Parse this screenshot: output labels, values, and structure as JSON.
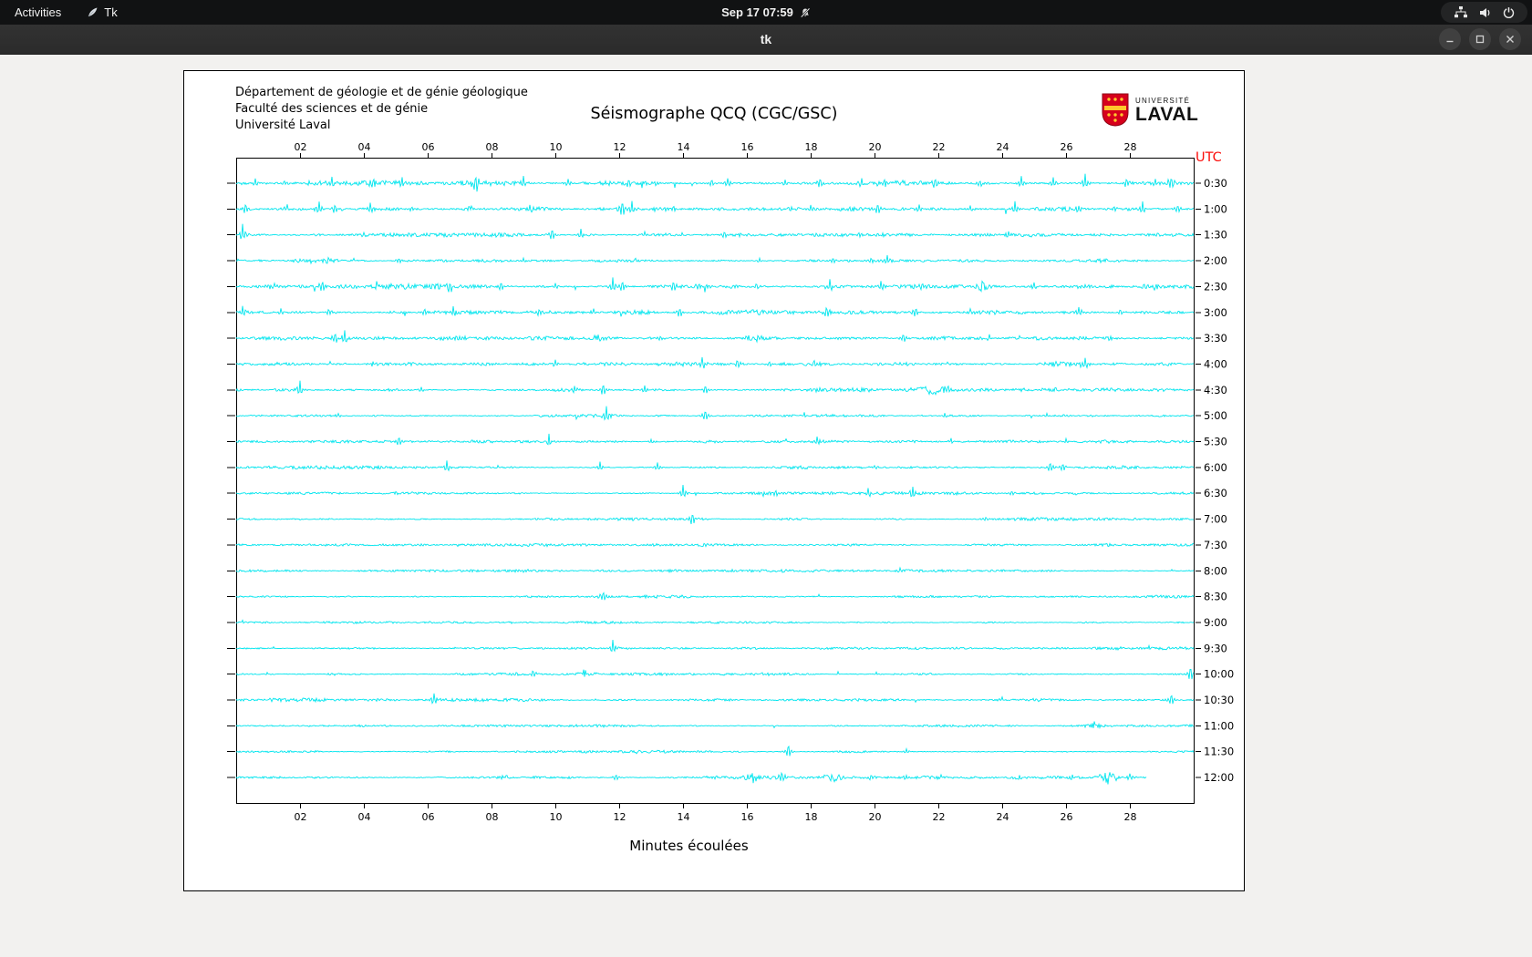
{
  "topbar": {
    "activities": "Activities",
    "app_name": "Tk",
    "clock": "Sep 17 07:59"
  },
  "window": {
    "title": "tk"
  },
  "canvas_header": {
    "line1": "Département de géologie et de génie géologique",
    "line2": "Faculté des sciences et de génie",
    "line3": "Université Laval"
  },
  "logo": {
    "top": "UNIVERSITÉ",
    "bottom": "LAVAL",
    "shield_red": "#d6001c",
    "shield_gold": "#ffc72c"
  },
  "chart_data": {
    "type": "line",
    "title": "Séismographe QCQ (CGC/GSC)",
    "xlabel": "Minutes écoulées",
    "utc_label": "UTC",
    "x_tick_labels": [
      "02",
      "04",
      "06",
      "08",
      "10",
      "12",
      "14",
      "16",
      "18",
      "20",
      "22",
      "24",
      "26",
      "28"
    ],
    "x_range_minutes": [
      0,
      30
    ],
    "trace_interval_minutes": 30,
    "legend_position": "none",
    "grid": false,
    "colors": {
      "trace": "#00e5ee",
      "axis": "#000000",
      "utc": "#fb0f0c"
    },
    "traces": [
      {
        "label": "0:30",
        "noise": 1.7,
        "events": [
          [
            0.6,
            5
          ],
          [
            1.5,
            4
          ],
          [
            3.0,
            7
          ],
          [
            4.3,
            10
          ],
          [
            5.2,
            5
          ],
          [
            7.5,
            13
          ],
          [
            9.0,
            7
          ],
          [
            10.4,
            5
          ],
          [
            12.3,
            6
          ],
          [
            13.1,
            4
          ],
          [
            14.9,
            5
          ],
          [
            15.4,
            6
          ],
          [
            17.2,
            4
          ],
          [
            18.3,
            7
          ],
          [
            19.6,
            4
          ],
          [
            20.3,
            5
          ],
          [
            21.9,
            9
          ],
          [
            23.3,
            4
          ],
          [
            24.6,
            8
          ],
          [
            25.6,
            6
          ],
          [
            26.6,
            11
          ],
          [
            27.9,
            6
          ],
          [
            28.8,
            5
          ],
          [
            29.3,
            12
          ]
        ]
      },
      {
        "label": "1:00",
        "noise": 1.8,
        "events": [
          [
            0.3,
            7
          ],
          [
            1.6,
            5
          ],
          [
            2.6,
            9,
            2
          ],
          [
            3.1,
            6
          ],
          [
            4.2,
            7
          ],
          [
            5.5,
            4
          ],
          [
            7.3,
            4
          ],
          [
            9.2,
            4
          ],
          [
            12.1,
            13,
            2
          ],
          [
            12.4,
            8
          ],
          [
            13.7,
            5
          ],
          [
            16.1,
            4
          ],
          [
            18.0,
            4
          ],
          [
            20.1,
            8
          ],
          [
            21.4,
            5
          ],
          [
            23.0,
            4
          ],
          [
            24.4,
            8
          ],
          [
            26.4,
            5
          ],
          [
            27.5,
            4
          ],
          [
            28.4,
            8
          ],
          [
            29.5,
            6
          ]
        ]
      },
      {
        "label": "1:30",
        "noise": 1.1,
        "events": [
          [
            0.2,
            11,
            2
          ],
          [
            4.0,
            3
          ],
          [
            9.9,
            9
          ],
          [
            10.8,
            6
          ],
          [
            12.8,
            4
          ],
          [
            15.3,
            6
          ],
          [
            19.5,
            3
          ],
          [
            24.2,
            4
          ]
        ]
      },
      {
        "label": "2:00",
        "noise": 1.0,
        "events": [
          [
            2.9,
            3,
            5
          ],
          [
            5.1,
            3
          ],
          [
            9.0,
            3
          ],
          [
            12.5,
            3
          ],
          [
            16.4,
            3
          ],
          [
            18.7,
            4
          ],
          [
            19.9,
            4
          ],
          [
            20.4,
            5
          ],
          [
            23.1,
            3
          ]
        ]
      },
      {
        "label": "2:30",
        "noise": 1.5,
        "events": [
          [
            1.2,
            4
          ],
          [
            2.7,
            8
          ],
          [
            4.4,
            4
          ],
          [
            6.7,
            8
          ],
          [
            8.3,
            6
          ],
          [
            10.0,
            4
          ],
          [
            11.8,
            10,
            2
          ],
          [
            12.1,
            8
          ],
          [
            13.7,
            7
          ],
          [
            14.5,
            5
          ],
          [
            16.3,
            4
          ],
          [
            18.6,
            8
          ],
          [
            20.2,
            6
          ],
          [
            21.5,
            5
          ],
          [
            23.4,
            6,
            4
          ],
          [
            25.0,
            4
          ],
          [
            26.5,
            4
          ],
          [
            28.6,
            5,
            5
          ]
        ]
      },
      {
        "label": "3:00",
        "noise": 1.5,
        "events": [
          [
            0.2,
            6
          ],
          [
            1.4,
            4
          ],
          [
            2.9,
            5
          ],
          [
            5.9,
            6
          ],
          [
            6.8,
            5
          ],
          [
            9.5,
            5
          ],
          [
            11.2,
            4
          ],
          [
            13.9,
            8,
            2
          ],
          [
            15.1,
            4
          ],
          [
            18.5,
            8
          ],
          [
            21.3,
            7
          ],
          [
            23.0,
            4
          ],
          [
            26.4,
            7
          ],
          [
            27.7,
            4
          ]
        ]
      },
      {
        "label": "3:30",
        "noise": 1.2,
        "events": [
          [
            3.1,
            10
          ],
          [
            3.4,
            8
          ],
          [
            7.0,
            3
          ],
          [
            11.3,
            5,
            5
          ],
          [
            13.3,
            3
          ],
          [
            16.2,
            5,
            4
          ],
          [
            18.9,
            3
          ],
          [
            20.9,
            6
          ],
          [
            22.5,
            4
          ],
          [
            23.6,
            5
          ],
          [
            27.4,
            3
          ]
        ]
      },
      {
        "label": "4:00",
        "noise": 1.2,
        "events": [
          [
            4.3,
            3
          ],
          [
            10.0,
            4
          ],
          [
            14.6,
            7
          ],
          [
            15.7,
            5
          ],
          [
            16.7,
            4
          ],
          [
            18.1,
            6
          ],
          [
            21.0,
            3
          ],
          [
            25.6,
            4,
            5
          ],
          [
            26.6,
            8
          ]
        ]
      },
      {
        "label": "4:30",
        "noise": 1.2,
        "events": [
          [
            2.0,
            9
          ],
          [
            5.8,
            3
          ],
          [
            10.6,
            6
          ],
          [
            11.5,
            9
          ],
          [
            12.8,
            5
          ],
          [
            14.7,
            6
          ],
          [
            18.2,
            3
          ],
          [
            21.8,
            7,
            6
          ],
          [
            22.3,
            5,
            3
          ]
        ]
      },
      {
        "label": "5:00",
        "noise": 0.9,
        "events": [
          [
            3.2,
            3
          ],
          [
            11.6,
            10
          ],
          [
            14.7,
            8
          ],
          [
            17.8,
            3
          ],
          [
            22.2,
            3
          ],
          [
            25.4,
            3
          ]
        ]
      },
      {
        "label": "5:30",
        "noise": 0.9,
        "events": [
          [
            5.1,
            7
          ],
          [
            9.8,
            8
          ],
          [
            13.0,
            3
          ],
          [
            18.2,
            5
          ],
          [
            22.4,
            3
          ],
          [
            26.0,
            3
          ]
        ]
      },
      {
        "label": "6:00",
        "noise": 0.9,
        "events": [
          [
            6.6,
            8
          ],
          [
            11.4,
            6
          ],
          [
            13.2,
            5
          ],
          [
            20.0,
            3
          ],
          [
            25.5,
            8
          ],
          [
            25.9,
            6
          ]
        ]
      },
      {
        "label": "6:30",
        "noise": 0.9,
        "events": [
          [
            14.0,
            9
          ],
          [
            16.9,
            5
          ],
          [
            19.8,
            7
          ],
          [
            21.2,
            6
          ],
          [
            24.3,
            3
          ]
        ]
      },
      {
        "label": "7:00",
        "noise": 0.85,
        "events": [
          [
            14.3,
            10
          ],
          [
            23.5,
            3
          ]
        ]
      },
      {
        "label": "7:30",
        "noise": 0.8,
        "events": []
      },
      {
        "label": "8:00",
        "noise": 0.8,
        "events": [
          [
            20.8,
            3
          ]
        ]
      },
      {
        "label": "8:30",
        "noise": 0.8,
        "events": [
          [
            11.5,
            8
          ]
        ]
      },
      {
        "label": "9:00",
        "noise": 0.75,
        "events": []
      },
      {
        "label": "9:30",
        "noise": 0.8,
        "events": [
          [
            11.8,
            10
          ]
        ]
      },
      {
        "label": "10:00",
        "noise": 0.9,
        "events": [
          [
            9.3,
            6
          ],
          [
            10.9,
            5,
            4
          ],
          [
            29.9,
            11,
            2
          ]
        ]
      },
      {
        "label": "10:30",
        "noise": 0.9,
        "events": [
          [
            6.2,
            7
          ],
          [
            24.0,
            3
          ],
          [
            29.3,
            9,
            2
          ]
        ]
      },
      {
        "label": "11:00",
        "noise": 0.8,
        "events": [
          [
            26.9,
            5,
            4
          ]
        ]
      },
      {
        "label": "11:30",
        "noise": 0.8,
        "events": [
          [
            17.3,
            9
          ],
          [
            21.0,
            3
          ]
        ]
      },
      {
        "label": "12:00",
        "noise": 1.0,
        "end": 0.95,
        "events": [
          [
            8.4,
            3,
            4
          ],
          [
            11.9,
            4
          ],
          [
            16.2,
            6,
            5
          ],
          [
            17.1,
            8
          ],
          [
            18.7,
            5,
            5
          ],
          [
            19.9,
            4
          ],
          [
            21.0,
            3
          ],
          [
            24.5,
            3,
            4
          ],
          [
            26.2,
            4
          ],
          [
            27.3,
            7,
            5
          ],
          [
            28.0,
            4
          ]
        ]
      }
    ]
  }
}
